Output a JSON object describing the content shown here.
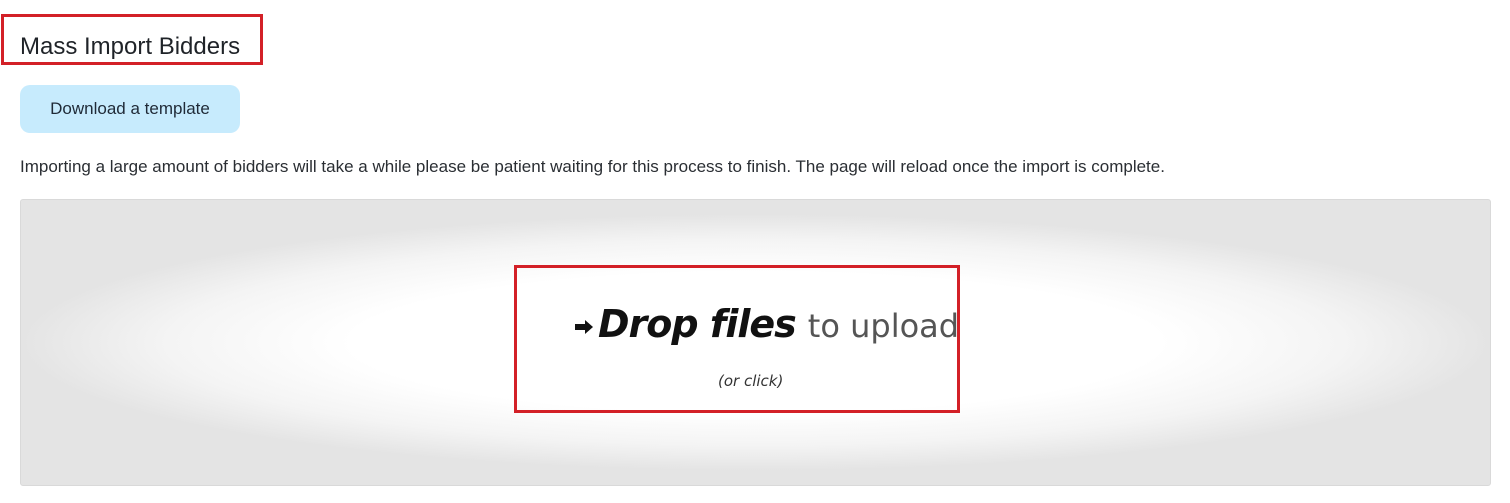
{
  "header": {
    "title": "Mass Import Bidders"
  },
  "actions": {
    "download_label": "Download a template"
  },
  "info": {
    "text": "Importing a large amount of bidders will take a while please be patient waiting for this process to finish. The page will reload once the import is complete."
  },
  "dropzone": {
    "icon": "arrow-right-icon",
    "primary": "Drop files",
    "secondary": "to upload",
    "hint": "(or click)"
  },
  "colors": {
    "highlight": "#d32027",
    "button_bg": "#c7ebfd"
  }
}
